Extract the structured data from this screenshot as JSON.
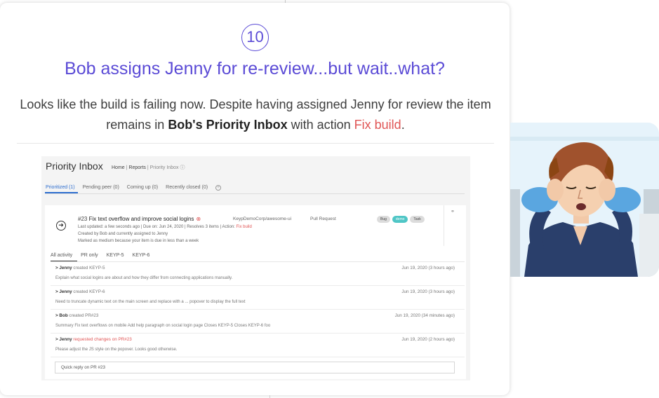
{
  "step": {
    "number": "10",
    "title": "Bob assigns Jenny for re-review...but wait..what?",
    "desc_part1": "Looks like the build is failing now. Despite having assigned Jenny for review the item remains in ",
    "desc_bold": "Bob's Priority Inbox",
    "desc_part2": " with action ",
    "desc_action": "Fix build",
    "desc_end": "."
  },
  "app": {
    "title": "Priority Inbox",
    "breadcrumbs": [
      "Home",
      "Reports",
      "Priority Inbox"
    ],
    "tabs": [
      "Prioritized (1)",
      "Pending peer (0)",
      "Coming up (0)",
      "Recently closed (0)"
    ],
    "item": {
      "number": "#23",
      "title": "Fix text overflow and improve social logins",
      "repo": "KeypDemoCorp/awesome-ui",
      "type": "Pull Request",
      "tags": [
        "Bug",
        "demo",
        "Task"
      ],
      "meta_line1_prefix": "Last updated: a few seconds ago  |  Due on: Jun 24, 2020  |  Resolves 3 items  |  Action: ",
      "meta_action": "Fix build",
      "meta_line2": "Created by Bob and currently assigned to Jenny",
      "meta_line3": "Marked as medium because your item is due in less than a week"
    },
    "subtabs": [
      "All activity",
      "PR only",
      "KEYP-5",
      "KEYP-6"
    ],
    "activities": [
      {
        "actor": "> Jenny",
        "verb": "created KEYP-5",
        "time": "Jun 19, 2020 (3 hours ago)",
        "body": "Explain what social logins are about and how they differ from connecting applications manually."
      },
      {
        "actor": "> Jenny",
        "verb": "created KEYP-6",
        "time": "Jun 19, 2020 (3 hours ago)",
        "body": "Need to truncate dynamic text on the main screen and replace with a ... popover to display the full text"
      },
      {
        "actor": "> Bob",
        "verb": "created PR#23",
        "time": "Jun 19, 2020 (34 minutes ago)",
        "body": "Summary Fix text overflows on mobile Add help paragraph on social login page Closes KEYP-5 Closes KEYP-6 foo"
      },
      {
        "actor": "> Jenny",
        "verb": "requested changes on PR#23",
        "time": "Jun 19, 2020 (2 hours ago)",
        "body": "Please adjust the JS style on the popover. Looks good otherwise."
      }
    ],
    "reply_placeholder": "Quick reply on PR #23"
  },
  "colors": {
    "accent": "#5b4bd6",
    "action_red": "#e05555",
    "tab_blue": "#2f6fcf",
    "demo_tag": "#4fc6c6"
  }
}
